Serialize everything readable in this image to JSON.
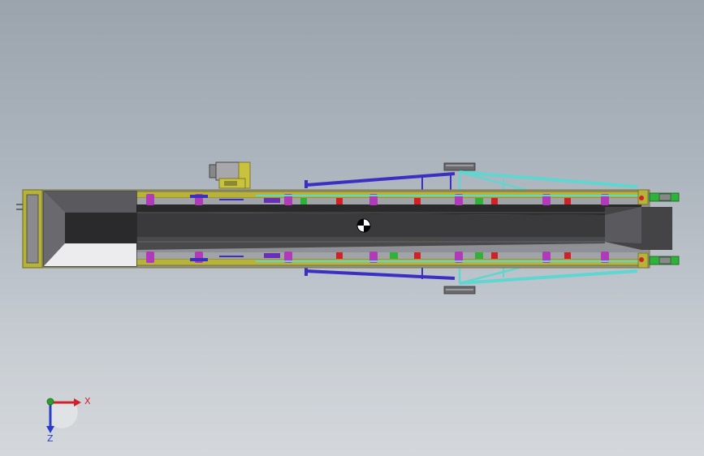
{
  "viewport": {
    "background_top": "#9ba3ad",
    "background_bottom": "#d4d8dc"
  },
  "triad": {
    "x_label": "X",
    "z_label": "Z",
    "x_color": "#d0202a",
    "y_color": "#2aa02a",
    "z_color": "#2a3cc8"
  },
  "colors": {
    "frame": "#b7b23a",
    "belt": "#2a2a2a",
    "belt_inner": "#4a4a4c",
    "brace_blue": "#3a2fc0",
    "brace_cyan": "#5fd6d0",
    "roller_magenta": "#b03ab8",
    "accent_red": "#d02028",
    "accent_green": "#2fb23a",
    "hopper": "#e8e8ea",
    "motor": "#c9c23e",
    "wheel": "#6a6a6e"
  },
  "icons": {
    "origin_marker": "origin-marker-icon",
    "triad": "coordinate-triad-icon"
  }
}
